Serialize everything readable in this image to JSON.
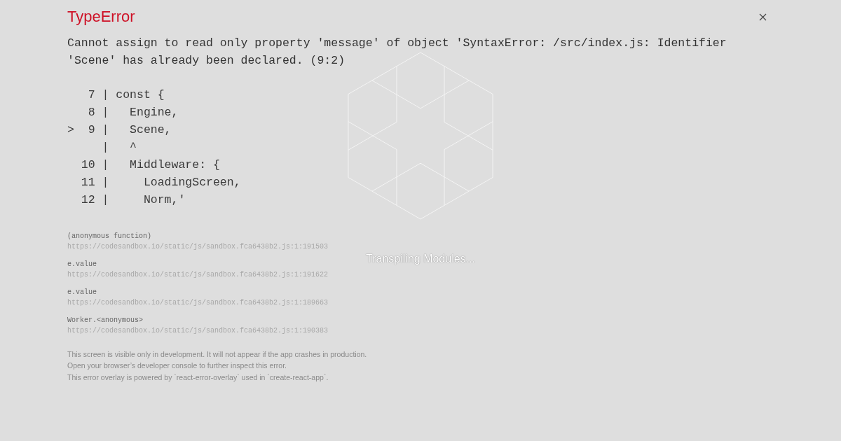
{
  "loader": {
    "text": "Transpiling Modules..."
  },
  "error": {
    "title": "TypeError",
    "message": "Cannot assign to read only property 'message' of object 'SyntaxError: /src/index.js: Identifier 'Scene' has already been declared. (9:2)",
    "code_frame": [
      "   7 | const {",
      "   8 |   Engine,",
      ">  9 |   Scene,",
      "     |   ^",
      "  10 |   Middleware: {",
      "  11 |     LoadingScreen,",
      "  12 |     Norm,'"
    ],
    "stack_frames": [
      {
        "function": "(anonymous function)",
        "location": "https://codesandbox.io/static/js/sandbox.fca6438b2.js:1:191503"
      },
      {
        "function": "e.value",
        "location": "https://codesandbox.io/static/js/sandbox.fca6438b2.js:1:191622"
      },
      {
        "function": "e.value",
        "location": "https://codesandbox.io/static/js/sandbox.fca6438b2.js:1:189663"
      },
      {
        "function": "Worker.<anonymous>",
        "location": "https://codesandbox.io/static/js/sandbox.fca6438b2.js:1:190383"
      }
    ],
    "footer": [
      "This screen is visible only in development. It will not appear if the app crashes in production.",
      "Open your browser’s developer console to further inspect this error.",
      "This error overlay is powered by `react-error-overlay` used in `create-react-app`."
    ]
  }
}
